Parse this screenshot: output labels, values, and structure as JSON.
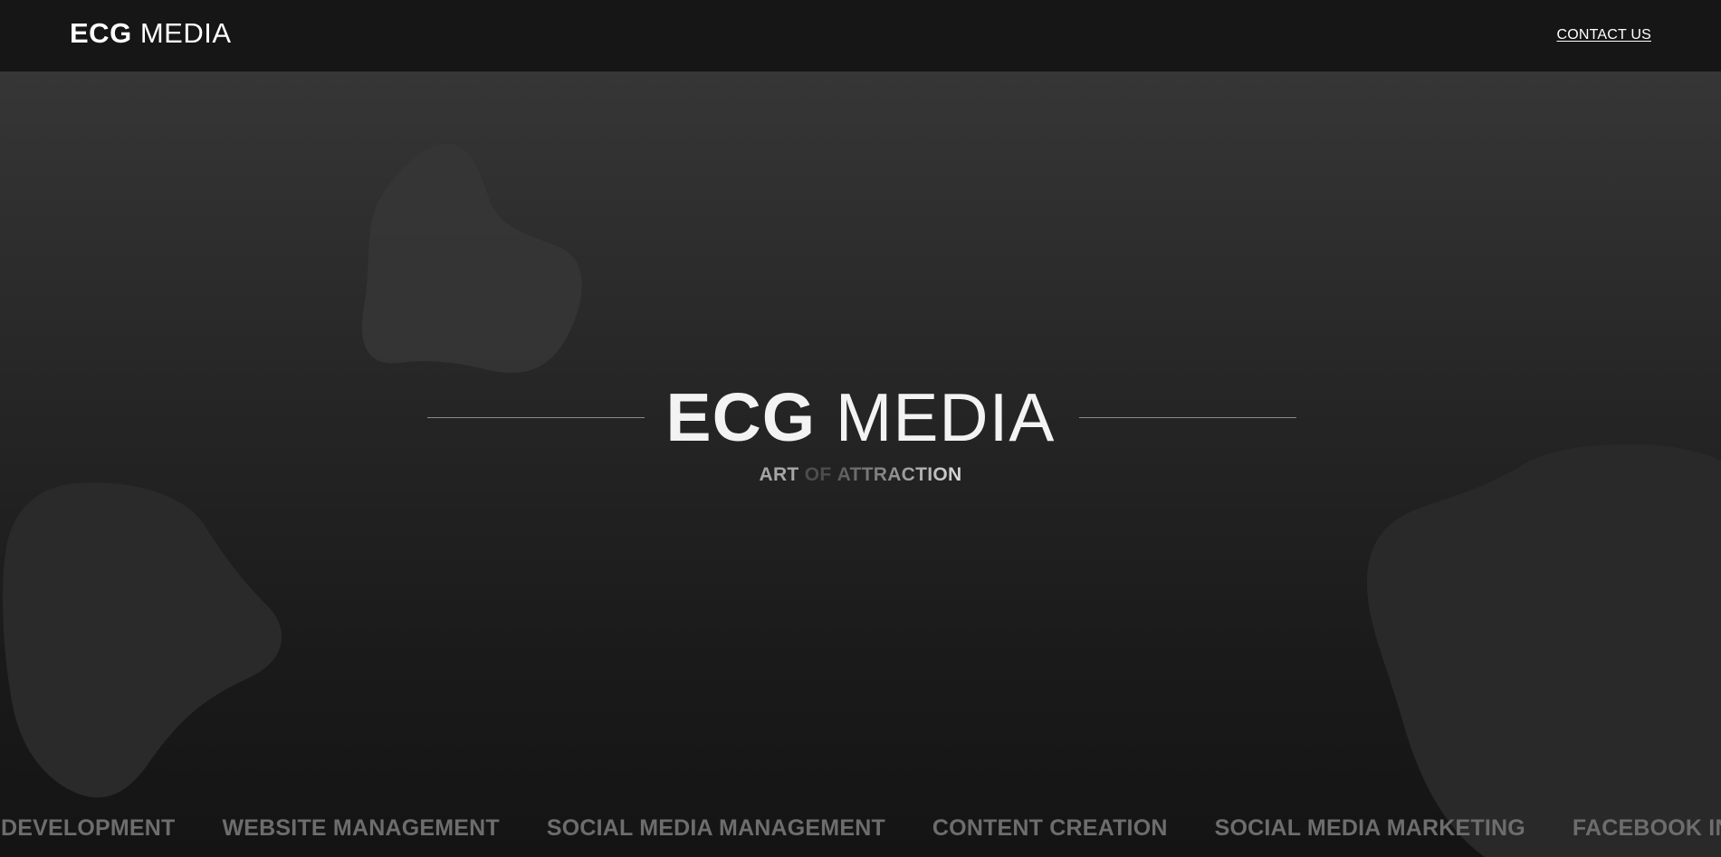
{
  "header": {
    "logo_strong": "ECG",
    "logo_light": "MEDIA",
    "contact_label": "CONTACT US"
  },
  "hero": {
    "title_strong": "ECG",
    "title_light": "MEDIA",
    "tagline": {
      "word1": "ART",
      "word2": "OF",
      "word3": "ATTRACTION"
    }
  },
  "services_ticker": [
    "DEVELOPMENT",
    "WEBSITE MANAGEMENT",
    "SOCIAL MEDIA MANAGEMENT",
    "CONTENT CREATION",
    "SOCIAL MEDIA MARKETING",
    "FACEBOOK INSTAGRA"
  ],
  "colors": {
    "navbar_bg": "#161616",
    "hero_top": "#363636",
    "hero_bottom": "#141414",
    "blob": "#2f2f2f",
    "text_primary": "#f3f3f3",
    "ticker_text": "#6d6d6d"
  }
}
